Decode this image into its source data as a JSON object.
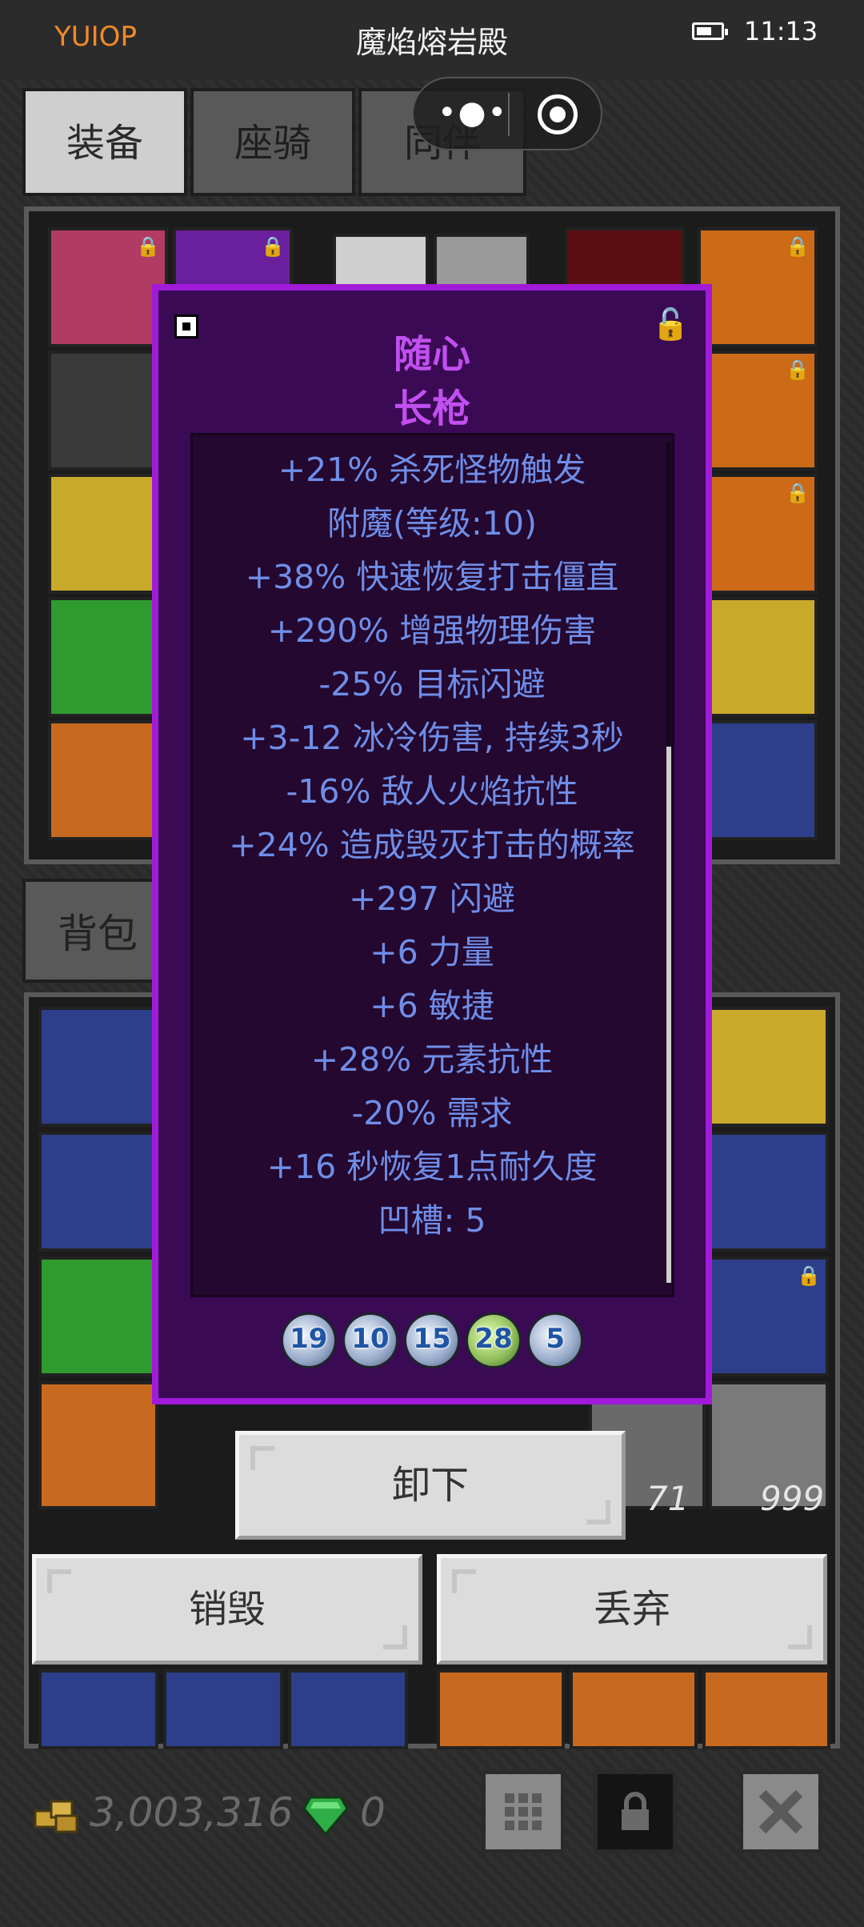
{
  "status": {
    "left_label": "YUIOP",
    "title": "魔焰熔岩殿",
    "time": "11:13"
  },
  "tabs": [
    {
      "label": "装备"
    },
    {
      "label": "座骑"
    },
    {
      "label": "同伴"
    }
  ],
  "backpack": {
    "tab_label": "背包 ("
  },
  "item": {
    "prefix": "随心",
    "name": "长枪",
    "stats": [
      "+21% 杀死怪物触发",
      "附魔(等级:10)",
      "+38% 快速恢复打击僵直",
      "+290% 增强物理伤害",
      "-25% 目标闪避",
      "+3-12 冰冷伤害, 持续3秒",
      "-16% 敌人火焰抗性",
      "+24% 造成毁灭打击的概率",
      "+297 闪避",
      "+6 力量",
      "+6 敏捷",
      "+28% 元素抗性",
      "-20% 需求",
      "+16 秒恢复1点耐久度",
      "凹槽: 5"
    ],
    "sockets": [
      "19",
      "10",
      "15",
      "28",
      "5"
    ]
  },
  "counts": {
    "fish_small": "71",
    "fish_big": "999"
  },
  "actions": {
    "unequip": "卸下",
    "destroy": "销毁",
    "discard": "丢弃"
  },
  "currency": {
    "gold": "3,003,316",
    "gems": "0"
  },
  "colors": {
    "accent_orange": "#f08a2a",
    "tooltip_border": "#a21ad9",
    "item_name": "#c24fef",
    "stat_text": "#6f8ee8"
  }
}
